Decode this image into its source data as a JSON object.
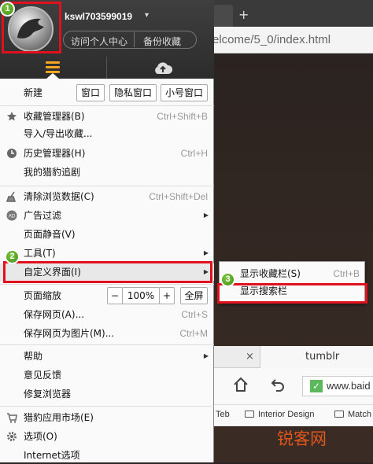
{
  "browser": {
    "tab_plus": "+",
    "url": "elcome/5_0/index.html",
    "inner_tab_close": "×",
    "inner_tab_title": "tumblr",
    "inner_url": "www.baid",
    "bookmarks": [
      "Teb",
      "Interior Design",
      "Match"
    ],
    "watermark": "锐客网"
  },
  "header": {
    "username": "kswl703599019",
    "user_caret": "▾",
    "visit_center": "访问个人中心",
    "backup_favorites": "备份收藏"
  },
  "new_row": {
    "label": "新建",
    "buttons": [
      "窗口",
      "隐私窗口",
      "小号窗口"
    ]
  },
  "menu": {
    "favorites_manager": {
      "label": "收藏管理器(B)",
      "shortcut": "Ctrl+Shift+B"
    },
    "import_export": {
      "label": "导入/导出收藏..."
    },
    "history_manager": {
      "label": "历史管理器(H)",
      "shortcut": "Ctrl+H"
    },
    "my_follow": {
      "label": "我的猎豹追剧"
    },
    "clear_data": {
      "label": "清除浏览数据(C)",
      "shortcut": "Ctrl+Shift+Del"
    },
    "ad_filter": {
      "label": "广告过滤"
    },
    "page_mute": {
      "label": "页面静音(V)"
    },
    "tools": {
      "label": "工具(T)"
    },
    "customize": {
      "label": "自定义界面(I)"
    },
    "zoom": {
      "label": "页面缩放",
      "minus": "−",
      "value": "100%",
      "plus": "+",
      "fullscreen": "全屏"
    },
    "save_page": {
      "label": "保存网页(A)...",
      "shortcut": "Ctrl+S"
    },
    "save_image": {
      "label": "保存网页为图片(M)...",
      "shortcut": "Ctrl+M"
    },
    "help": {
      "label": "帮助"
    },
    "feedback": {
      "label": "意见反馈"
    },
    "repair": {
      "label": "修复浏览器"
    },
    "app_market": {
      "label": "猎豹应用市场(E)"
    },
    "options": {
      "label": "选项(O)"
    },
    "internet_options": {
      "label": "Internet选项"
    }
  },
  "submenu": {
    "show_favbar": {
      "label": "显示收藏栏(S)",
      "shortcut": "Ctrl+B"
    },
    "show_searchbar": {
      "label": "显示搜索栏"
    }
  },
  "annotations": {
    "badge1": "1",
    "badge2": "2",
    "badge3": "3",
    "color": "#e0101f"
  },
  "colors": {
    "accent": "#f5a623",
    "header": "#333333"
  },
  "icons": [
    "star-icon",
    "clock-icon",
    "broom-icon",
    "ad-icon",
    "cart-icon",
    "gear-icon",
    "cloud-upload-icon",
    "menu-icon",
    "home-icon",
    "back-icon",
    "folder-icon",
    "check-icon"
  ]
}
